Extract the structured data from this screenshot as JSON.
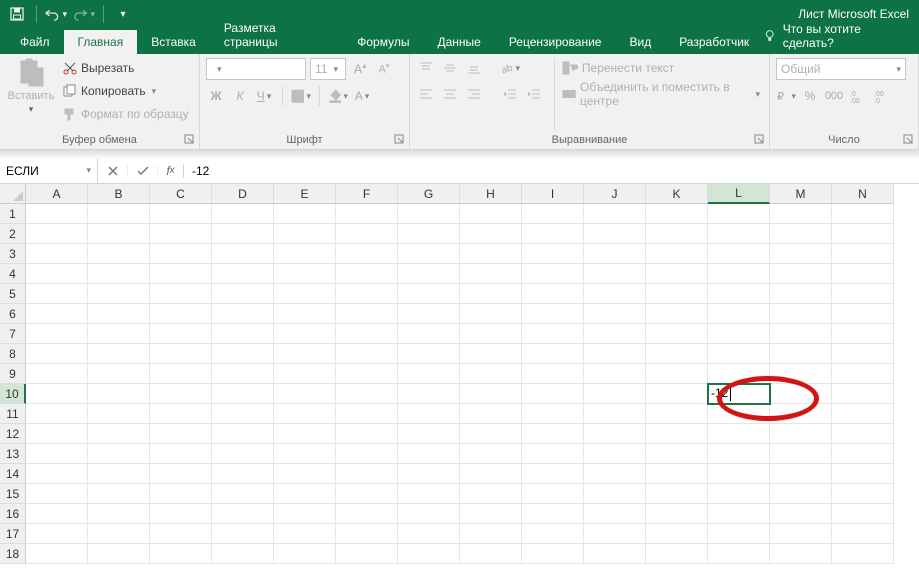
{
  "app": {
    "title": "Лист Microsoft Excel"
  },
  "quick_access": {
    "save": "save",
    "undo": "undo",
    "redo": "redo"
  },
  "tabs": {
    "file": "Файл",
    "items": [
      "Главная",
      "Вставка",
      "Разметка страницы",
      "Формулы",
      "Данные",
      "Рецензирование",
      "Вид",
      "Разработчик"
    ],
    "active_index": 0,
    "tell_me": "Что вы хотите сделать?"
  },
  "ribbon": {
    "clipboard": {
      "paste": "Вставить",
      "cut": "Вырезать",
      "copy": "Копировать",
      "format_painter": "Формат по образцу",
      "group": "Буфер обмена"
    },
    "font": {
      "font_name": "",
      "size": "11",
      "group": "Шрифт",
      "bold": "Ж",
      "italic": "К",
      "underline": "Ч"
    },
    "alignment": {
      "wrap": "Перенести текст",
      "merge": "Объединить и поместить в центре",
      "group": "Выравнивание"
    },
    "number": {
      "format": "Общий",
      "group": "Число"
    }
  },
  "name_box": {
    "value": "ЕСЛИ"
  },
  "formula_bar": {
    "value": "-12"
  },
  "grid": {
    "columns": [
      "A",
      "B",
      "C",
      "D",
      "E",
      "F",
      "G",
      "H",
      "I",
      "J",
      "K",
      "L",
      "M",
      "N"
    ],
    "row_count": 18,
    "active_col": 11,
    "active_row": 9,
    "edit_cell": {
      "row": 9,
      "col": 11,
      "value": "-12"
    }
  }
}
